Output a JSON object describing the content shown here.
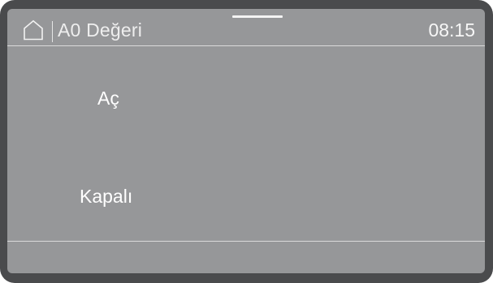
{
  "header": {
    "home_icon": "home-icon",
    "title": "A0 Değeri",
    "time": "08:15"
  },
  "options": {
    "on_label": "Aç",
    "off_label": "Kapalı"
  }
}
